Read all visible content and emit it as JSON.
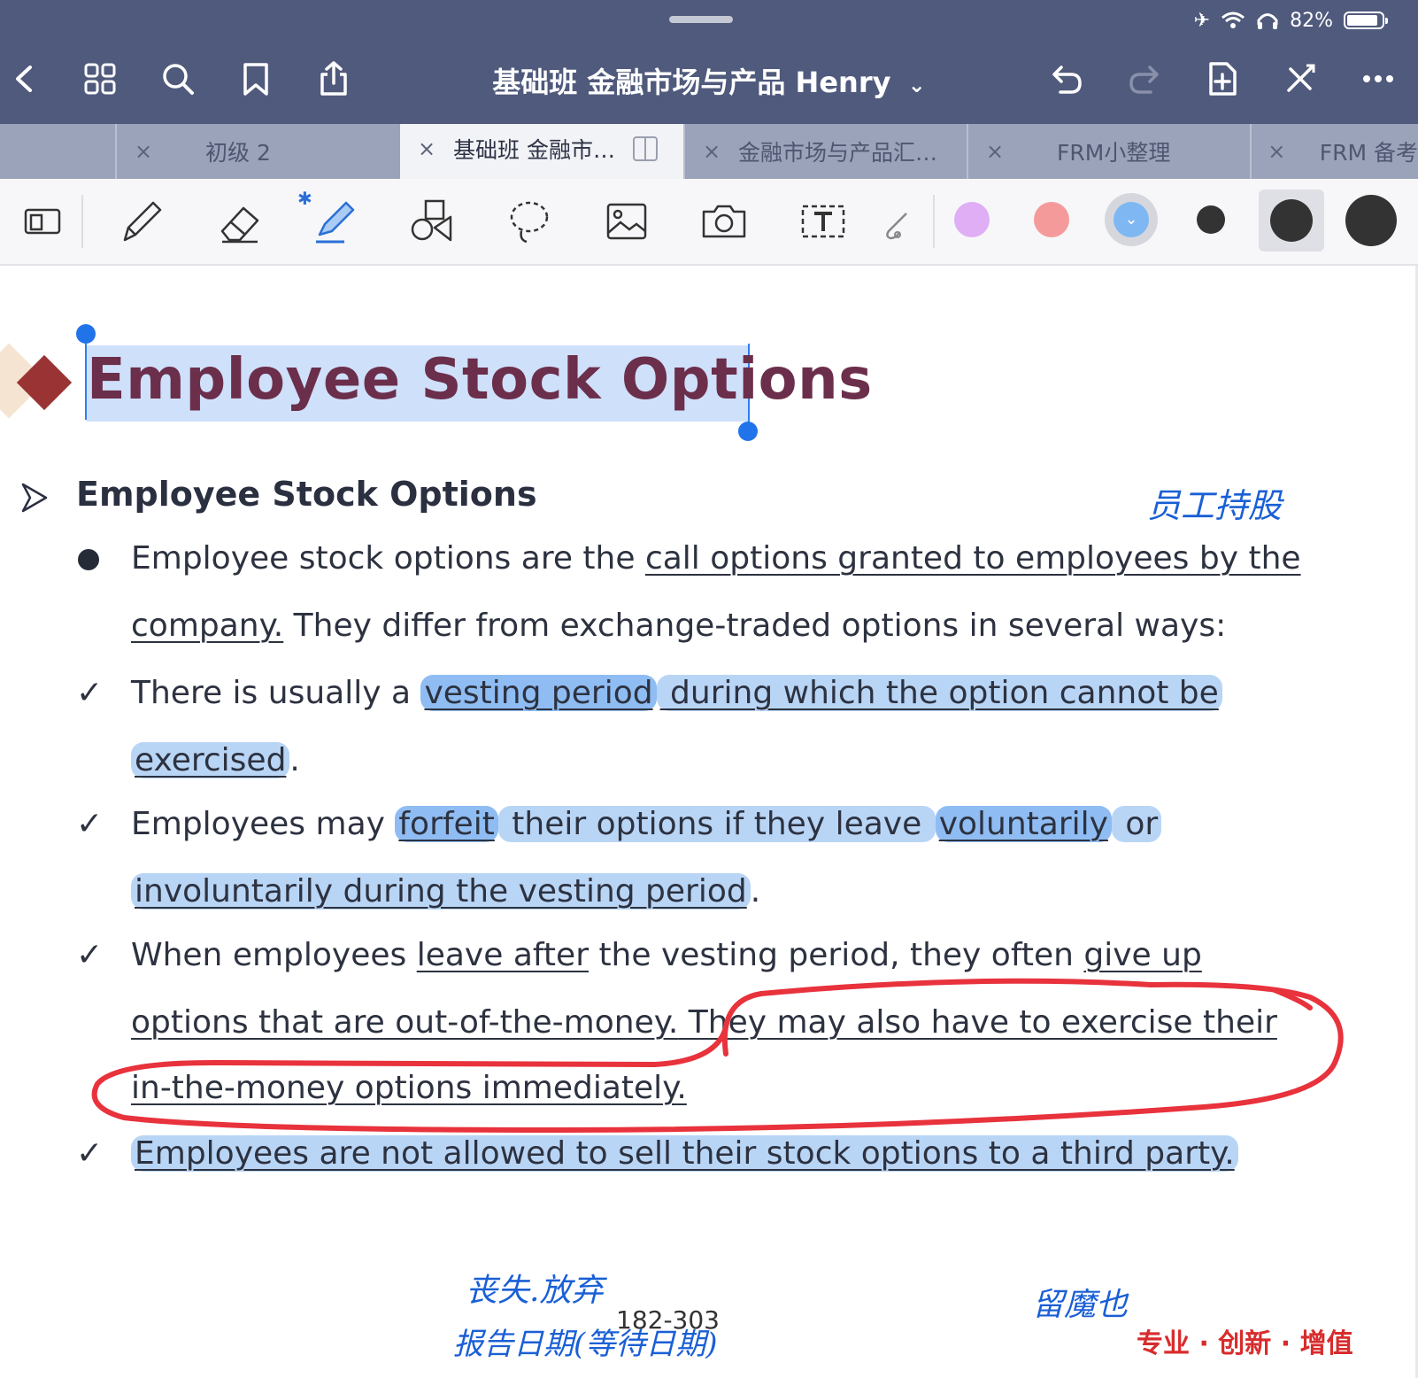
{
  "status_bar": {
    "battery": "82%"
  },
  "header": {
    "title": "基础班 金融市场与产品 Henry",
    "title_caret": "⌄"
  },
  "tabs": [
    {
      "label": "初级 2",
      "close": "×"
    },
    {
      "label": "基础班 金融市…",
      "close": "×",
      "active": true
    },
    {
      "label": "金融市场与产品汇…",
      "close": "×"
    },
    {
      "label": "FRM小整理",
      "close": "×"
    },
    {
      "label": "FRM 备考",
      "close": "×"
    }
  ],
  "toolbar": {
    "tools": [
      "layout-icon",
      "pen-icon",
      "eraser-icon",
      "highlighter-icon",
      "shapes-icon",
      "lasso-icon",
      "image-icon",
      "camera-icon",
      "text-box-icon",
      "pointer-icon"
    ],
    "colors": [
      "#e0aef5",
      "#f59a9a",
      "#7fb7f2"
    ],
    "sizes": [
      "#333333",
      "#333333",
      "#333333"
    ]
  },
  "document": {
    "heading": "Employee Stock Options",
    "section": "Employee Stock Options",
    "bullet": {
      "line1_a": "Employee stock options are the ",
      "line1_b": "call options granted to employees by the",
      "line2_a": "company.",
      "line2_b": " They differ from exchange-traded options in several ways:"
    },
    "checks": [
      {
        "a": "There  is  usually  a  ",
        "b": "vesting  period",
        "c": " during  which  the  option  cannot  be",
        "d": "exercised",
        "e": "."
      },
      {
        "a": "Employees   may  ",
        "b": "forfeit",
        "c": "  their   options   if   they   leave  ",
        "d": "voluntarily",
        "e": "  or",
        "f": "involuntarily during the vesting period",
        "g": "."
      },
      {
        "a": "When  employees  ",
        "b": "leave  after",
        "c": "  the  vesting  period,  they  often  ",
        "d": "give  up",
        "e": "options that are out-of-the-money.",
        "f": " They may also have to exercise their",
        "g": "in-the-money options immediately."
      },
      {
        "a": "Employees are not allowed to sell their stock options to a third party."
      }
    ],
    "check_mark": "✓",
    "handwritten": {
      "top_right": "员工持股",
      "bottom_left_1": "丧失.放弃",
      "bottom_left_2": "报告日期(等待日期)",
      "bottom_right": "留魔也"
    },
    "page_number": "182-303",
    "brand": "专业 · 创新 · 增值"
  }
}
